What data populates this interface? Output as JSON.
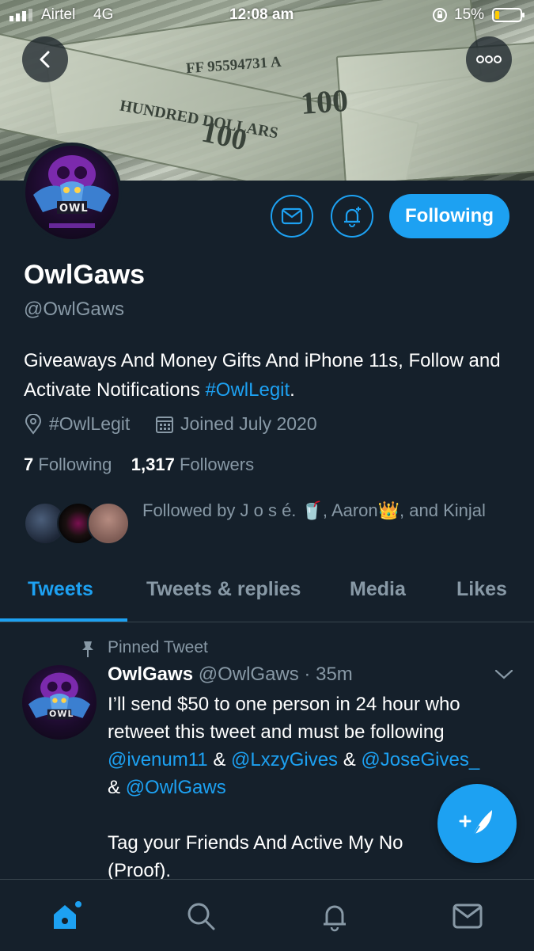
{
  "status_bar": {
    "carrier": "Airtel",
    "network": "4G",
    "time": "12:08 am",
    "battery": "15%"
  },
  "profile": {
    "name": "OwlGaws",
    "handle": "@OwlGaws",
    "avatar_text": "OWL",
    "bio_text": "Giveaways And Money Gifts And iPhone 11s, Follow and Activate Notifications ",
    "bio_hashtag": "#OwlLegit",
    "bio_end": ".",
    "location": "#OwlLegit",
    "joined": "Joined July 2020",
    "following_count": "7",
    "following_label": "Following",
    "followers_count": "1,317",
    "followers_label": "Followers",
    "followed_by_text": "Followed by J o s é. 🥤, Aaron👑, and Kinjal",
    "follow_button": "Following"
  },
  "banner": {
    "serial": "FF 95594731 A",
    "denomination": "100",
    "text": "HUNDRED DOLLARS"
  },
  "tabs": [
    "Tweets",
    "Tweets & replies",
    "Media",
    "Likes"
  ],
  "pinned_tweet": {
    "pinned_label": "Pinned Tweet",
    "author": "OwlGaws",
    "handle_time": "@OwlGaws · 35m",
    "text_1": "I’ll send $50 to one person in 24 hour who retweet this tweet and must be following ",
    "mention_1": "@ivenum11",
    "sep_1": " & ",
    "mention_2": "@LxzyGives",
    "sep_2": " & ",
    "mention_3": "@JoseGives_",
    "sep_3": " & ",
    "mention_4": "@OwlGaws",
    "text_2": "Tag your Friends And Active My No",
    "text_3": "(Proof)."
  },
  "colors": {
    "background": "#15202b",
    "accent": "#1da1f2",
    "secondary_text": "#8899a6",
    "divider": "#38444d"
  },
  "icons": [
    "back-arrow-icon",
    "more-icon",
    "mail-icon",
    "bell-plus-icon",
    "location-pin-icon",
    "calendar-icon",
    "pin-icon",
    "chevron-down-icon",
    "compose-feather-icon",
    "home-icon",
    "search-icon",
    "notifications-icon",
    "messages-icon"
  ]
}
